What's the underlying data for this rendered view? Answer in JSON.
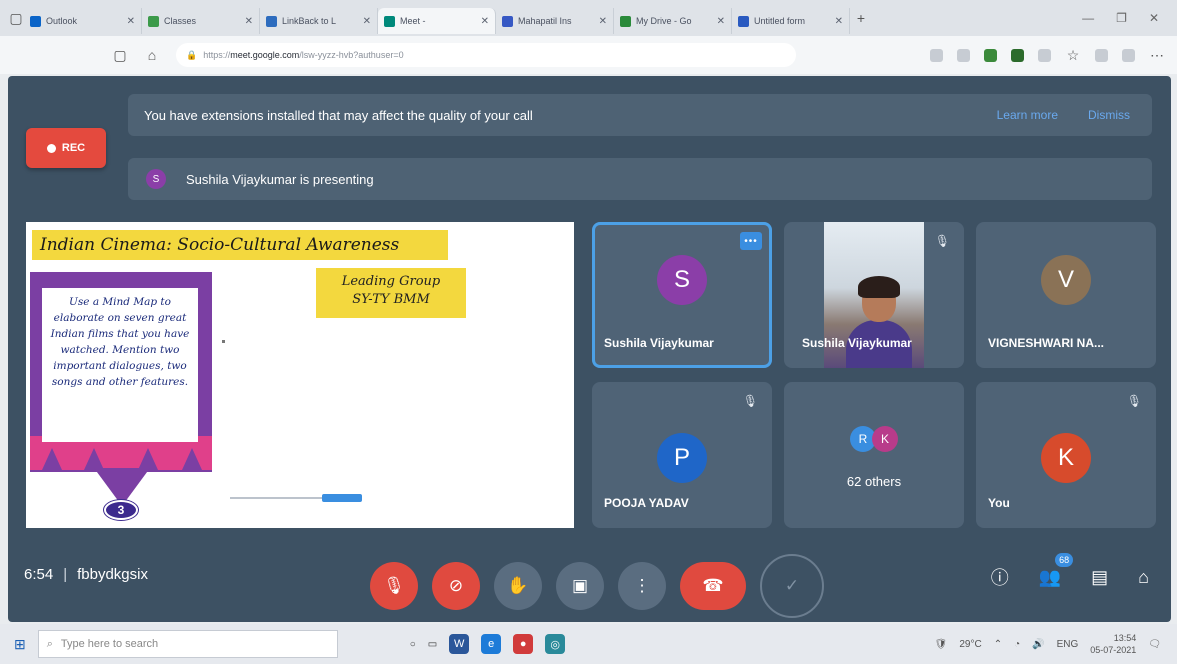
{
  "browser": {
    "tabs": [
      {
        "title": "Outlook",
        "color": "#0a64c8"
      },
      {
        "title": "Classes",
        "color": "#3c9a4a"
      },
      {
        "title": "LinkBack to L",
        "color": "#2d6cbe"
      },
      {
        "title": "Meet -",
        "color": "#00897b"
      },
      {
        "title": "Mahapatil Ins",
        "color": "#3658c4"
      },
      {
        "title": "My Drive - Go",
        "color": "#2a8a3a"
      },
      {
        "title": "Untitled form",
        "color": "#2a5ac0"
      }
    ],
    "url_prefix": "https://",
    "url_domain": "meet.google.com",
    "url_path": "/lsw-yyzz-hvb?authuser=0"
  },
  "meet": {
    "rec_label": "REC",
    "extension_warning": "You have extensions installed that may affect the quality of your call",
    "warning_links": [
      "Learn more",
      "Dismiss"
    ],
    "presenter_initial": "S",
    "presenting_text": "Sushila Vijaykumar is presenting",
    "slide": {
      "title": "Indian Cinema: Socio-Cultural Awareness",
      "subtitle_line1": "Leading Group",
      "subtitle_line2": "SY-TY BMM",
      "note": "Use a Mind Map to elaborate on seven great Indian films that you have watched. Mention two important dialogues, two songs and other features.",
      "step_number": "3"
    },
    "tiles": [
      {
        "name": "Sushila Vijaykumar",
        "initial": "S",
        "color": "#8b3ea8"
      },
      {
        "name": "Sushila Vijaykumar"
      },
      {
        "name": "VIGNESHWARI NA...",
        "initial": "V",
        "color": "#8a7256"
      },
      {
        "name": "POOJA YADAV",
        "initial": "P",
        "color": "#1f66c8"
      },
      {
        "others_label": "62 others",
        "initials": [
          "R",
          "K"
        ],
        "colors": [
          "#3a8ee0",
          "#b83b8a"
        ]
      },
      {
        "name": "You",
        "initial": "K",
        "color": "#d74b2c"
      }
    ],
    "time": "6:54",
    "meeting_code": "fbbydkgsix",
    "participants_badge": "68"
  },
  "taskbar": {
    "search_placeholder": "Type here to search",
    "weather": "29°C",
    "language": "ENG",
    "time": "13:54",
    "date": "05-07-2021"
  }
}
